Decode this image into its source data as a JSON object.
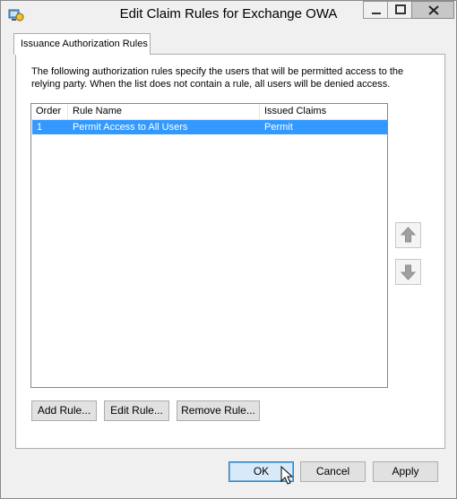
{
  "window": {
    "title": "Edit Claim Rules for Exchange OWA"
  },
  "tabs": [
    {
      "label": "Issuance Authorization Rules"
    }
  ],
  "description": "The following authorization rules specify the users that will be permitted access to the relying party. When the list does not contain a rule, all users will be denied access.",
  "table": {
    "columns": [
      "Order",
      "Rule Name",
      "Issued Claims"
    ],
    "rows": [
      {
        "order": "1",
        "rule_name": "Permit Access to All Users",
        "issued_claims": "Permit",
        "selected": true
      }
    ]
  },
  "actions": {
    "add_rule": "Add Rule...",
    "edit_rule": "Edit Rule...",
    "remove_rule": "Remove Rule..."
  },
  "footer": {
    "ok": "OK",
    "cancel": "Cancel",
    "apply": "Apply"
  },
  "icons": {
    "app": "claim-rules-app-icon",
    "move_up": "arrow-up-icon",
    "move_down": "arrow-down-icon",
    "cursor": "mouse-pointer-icon"
  },
  "colors": {
    "selection": "#3399ff",
    "default_button": "#d8eaf9"
  }
}
